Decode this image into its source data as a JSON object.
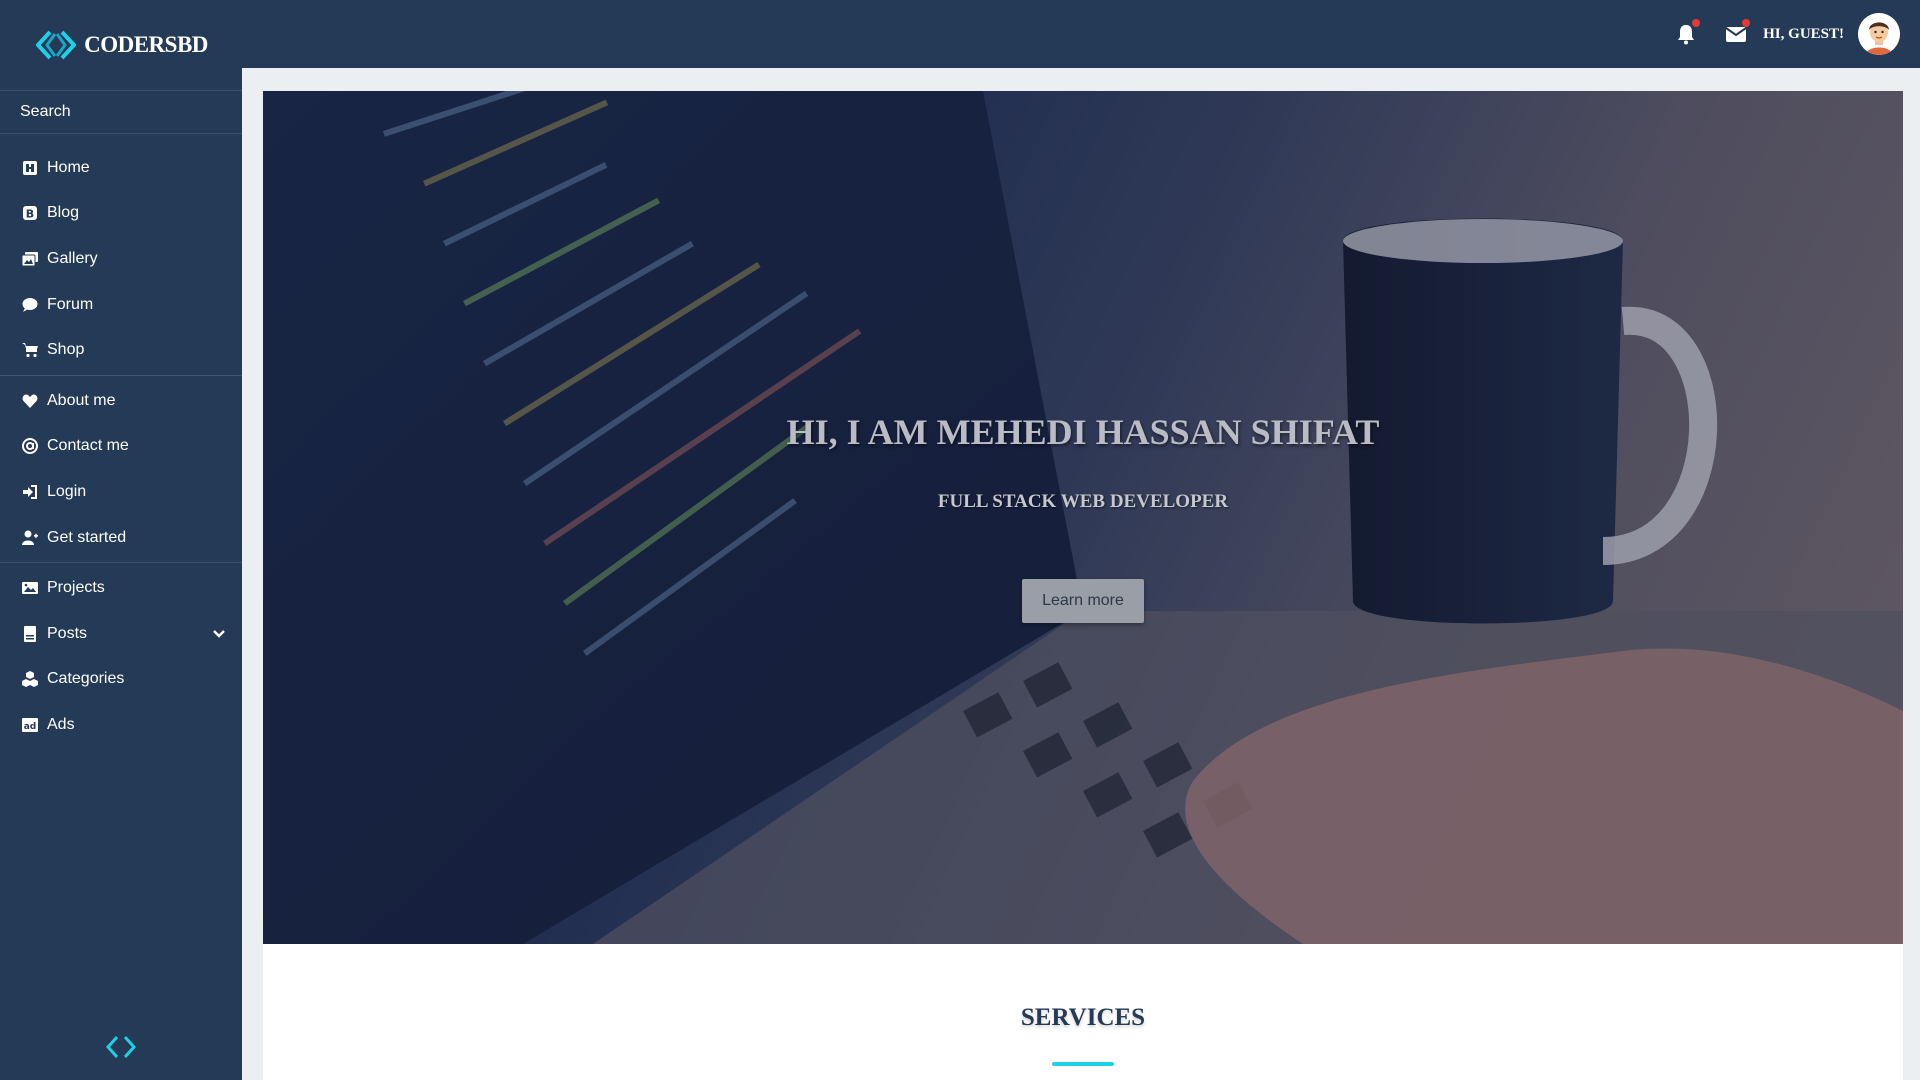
{
  "brand": {
    "name": "CODERSBD",
    "accent": "#1fd1e6"
  },
  "sidebar": {
    "search_label": "Search",
    "groups": [
      {
        "items": [
          {
            "label": "Home",
            "icon": "home-icon"
          },
          {
            "label": "Blog",
            "icon": "blog-icon"
          },
          {
            "label": "Gallery",
            "icon": "gallery-icon"
          },
          {
            "label": "Forum",
            "icon": "forum-icon"
          },
          {
            "label": "Shop",
            "icon": "shop-cart-icon"
          }
        ]
      },
      {
        "items": [
          {
            "label": "About me",
            "icon": "heart-icon"
          },
          {
            "label": "Contact me",
            "icon": "at-sign-icon"
          },
          {
            "label": "Login",
            "icon": "login-icon"
          },
          {
            "label": "Get started",
            "icon": "user-plus-icon"
          }
        ]
      },
      {
        "items": [
          {
            "label": "Projects",
            "icon": "image-icon"
          },
          {
            "label": "Posts",
            "icon": "document-icon",
            "expandable": true
          },
          {
            "label": "Categories",
            "icon": "cubes-icon"
          },
          {
            "label": "Ads",
            "icon": "ad-icon"
          }
        ]
      }
    ]
  },
  "topbar": {
    "greeting": "HI, GUEST!",
    "notifications_icon": "bell-icon",
    "messages_icon": "envelope-icon",
    "badge_color": "#e53935"
  },
  "hero": {
    "title": "HI, I AM MEHEDI HASSAN SHIFAT",
    "subtitle": "FULL STACK WEB DEVELOPER",
    "button_label": "Learn more"
  },
  "services": {
    "title": "SERVICES"
  },
  "colors": {
    "sidebar_bg": "#243a56",
    "page_bg": "#eceff1"
  }
}
